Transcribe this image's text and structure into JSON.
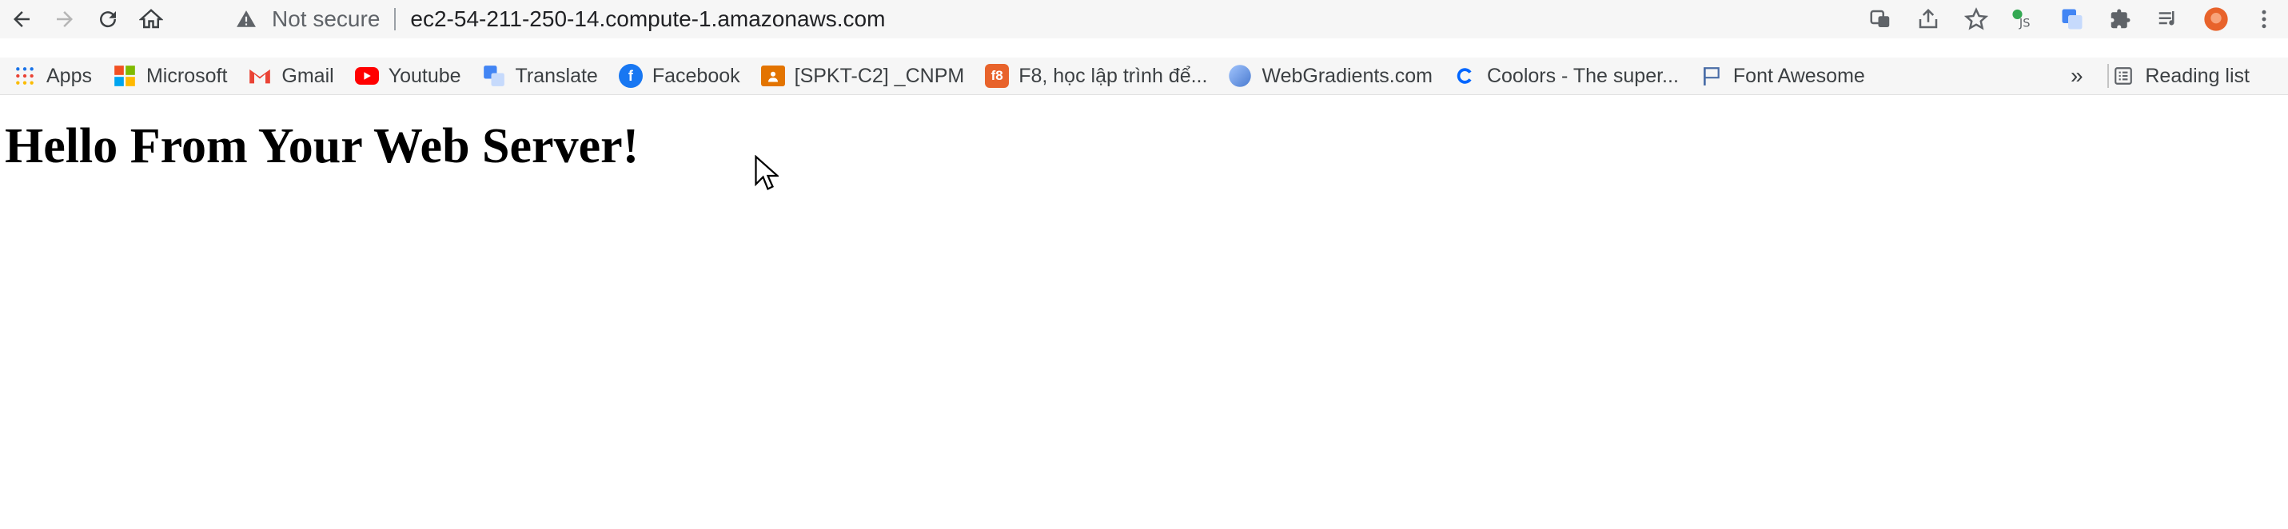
{
  "address_bar": {
    "security_label": "Not secure",
    "url": "ec2-54-211-250-14.compute-1.amazonaws.com"
  },
  "bookmarks": [
    {
      "label": "Apps",
      "icon": "apps-grid-icon"
    },
    {
      "label": "Microsoft",
      "icon": "microsoft-icon"
    },
    {
      "label": "Gmail",
      "icon": "gmail-icon"
    },
    {
      "label": "Youtube",
      "icon": "youtube-icon"
    },
    {
      "label": "Translate",
      "icon": "translate-icon"
    },
    {
      "label": "Facebook",
      "icon": "facebook-icon"
    },
    {
      "label": "[SPKT-C2] _CNPM",
      "icon": "classroom-icon"
    },
    {
      "label": "F8, học lập trình để...",
      "icon": "f8-icon"
    },
    {
      "label": "WebGradients.com",
      "icon": "webgradients-icon"
    },
    {
      "label": "Coolors - The super...",
      "icon": "coolors-icon"
    },
    {
      "label": "Font Awesome",
      "icon": "flag-icon"
    }
  ],
  "reading_list_label": "Reading list",
  "page": {
    "heading": "Hello From Your Web Server!"
  },
  "colors": {
    "youtube": "#ff0000",
    "facebook": "#1877f2",
    "coolors": "#0066ff",
    "f8": "#e8632b",
    "classroom": "#e37400"
  }
}
